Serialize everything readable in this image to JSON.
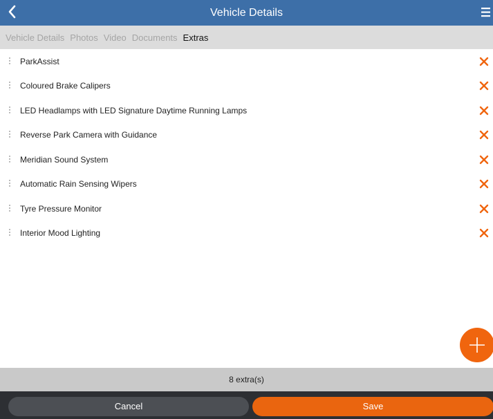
{
  "header": {
    "title": "Vehicle Details",
    "back_icon": "chevron-left-icon",
    "menu_icon": "hamburger-menu-icon"
  },
  "tabs": [
    {
      "label": "Vehicle Details",
      "active": false
    },
    {
      "label": "Photos",
      "active": false
    },
    {
      "label": "Video",
      "active": false
    },
    {
      "label": "Documents",
      "active": false
    },
    {
      "label": "Extras",
      "active": true
    }
  ],
  "extras": [
    {
      "label": "ParkAssist"
    },
    {
      "label": "Coloured Brake Calipers"
    },
    {
      "label": "LED Headlamps with LED Signature Daytime Running Lamps"
    },
    {
      "label": "Reverse Park Camera with Guidance"
    },
    {
      "label": "Meridian Sound System"
    },
    {
      "label": "Automatic Rain Sensing Wipers"
    },
    {
      "label": "Tyre Pressure Monitor"
    },
    {
      "label": "Interior Mood Lighting"
    }
  ],
  "status": {
    "count_text": "8 extra(s)"
  },
  "actions": {
    "cancel_label": "Cancel",
    "save_label": "Save"
  },
  "colors": {
    "header": "#3d6fa8",
    "accent": "#f0650e",
    "tabs_bg": "#dcdcdc",
    "status_bg": "#c9c9c9",
    "actions_bg": "#2d2f33"
  }
}
